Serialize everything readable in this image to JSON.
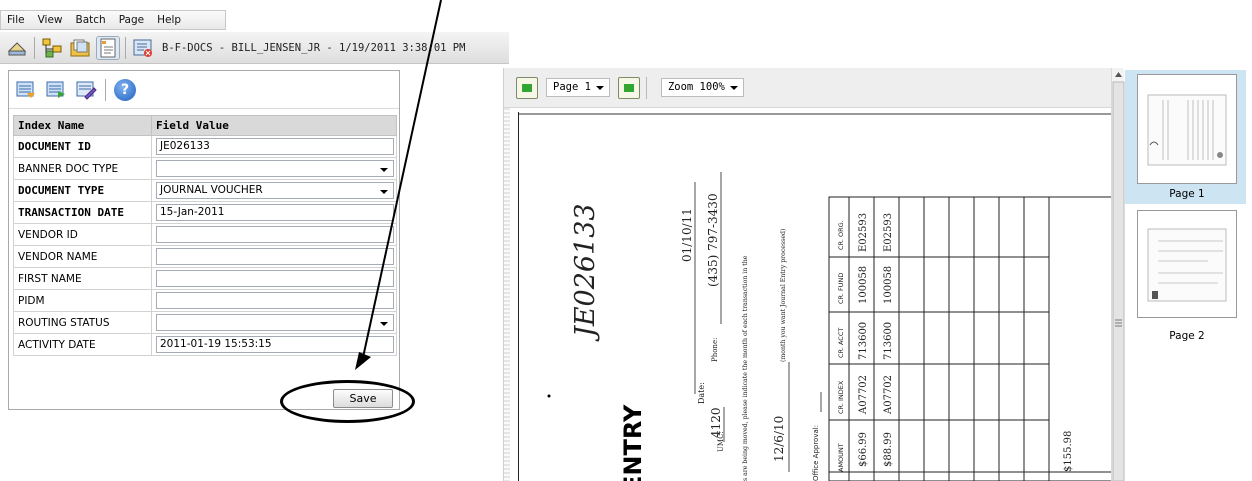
{
  "menubar": {
    "items": [
      "File",
      "View",
      "Batch",
      "Page",
      "Help"
    ]
  },
  "toolbar": {
    "title": "B-F-DOCS - BILL_JENSEN_JR - 1/19/2011 3:38:01 PM"
  },
  "index_table": {
    "headers": [
      "Index Name",
      "Field Value"
    ],
    "rows": [
      {
        "name": "DOCUMENT ID",
        "value": "JE026133",
        "bold": true,
        "dropdown": false
      },
      {
        "name": "BANNER DOC TYPE",
        "value": "",
        "bold": false,
        "dropdown": true
      },
      {
        "name": "DOCUMENT TYPE",
        "value": "JOURNAL VOUCHER",
        "bold": true,
        "dropdown": true
      },
      {
        "name": "TRANSACTION DATE",
        "value": "15-Jan-2011",
        "bold": true,
        "dropdown": false
      },
      {
        "name": "VENDOR ID",
        "value": "",
        "bold": false,
        "dropdown": false
      },
      {
        "name": "VENDOR NAME",
        "value": "",
        "bold": false,
        "dropdown": false
      },
      {
        "name": "FIRST NAME",
        "value": "",
        "bold": false,
        "dropdown": false
      },
      {
        "name": "PIDM",
        "value": "",
        "bold": false,
        "dropdown": false
      },
      {
        "name": "ROUTING STATUS",
        "value": "",
        "bold": false,
        "dropdown": true
      },
      {
        "name": "ACTIVITY DATE",
        "value": "2011-01-19 15:53:15",
        "bold": false,
        "dropdown": false
      }
    ],
    "save_label": "Save"
  },
  "viewer": {
    "page_select": "Page 1",
    "zoom_select": "Zoom 100%"
  },
  "document": {
    "handwritten_id": "JE026133",
    "date_label": "Date:",
    "date_value": "01/10/11",
    "phone_label": "Phone:",
    "phone_value": "(435) 797-3430",
    "umc_label": "UMC:",
    "umc_value": "4120",
    "note_line1": "s are being moved, please indicate the month of each transaction in the",
    "note_line2": "(month you want Journal Entry processed)",
    "month_value": "12/6/10",
    "office_approval": "Office Approval:",
    "heading_fragment": "ENTRY",
    "columns": [
      "AMOUNT",
      "CR. INDEX",
      "CR. ACCT",
      "CR. FUND",
      "CR. ORG."
    ],
    "rows": [
      [
        "$66.99",
        "A07702",
        "713600",
        "100058",
        "E02593"
      ],
      [
        "$88.99",
        "A07702",
        "713600",
        "100058",
        "E02593"
      ]
    ],
    "total": "$155.98"
  },
  "thumbnails": [
    {
      "label": "Page 1",
      "selected": true
    },
    {
      "label": "Page 2",
      "selected": false
    }
  ]
}
